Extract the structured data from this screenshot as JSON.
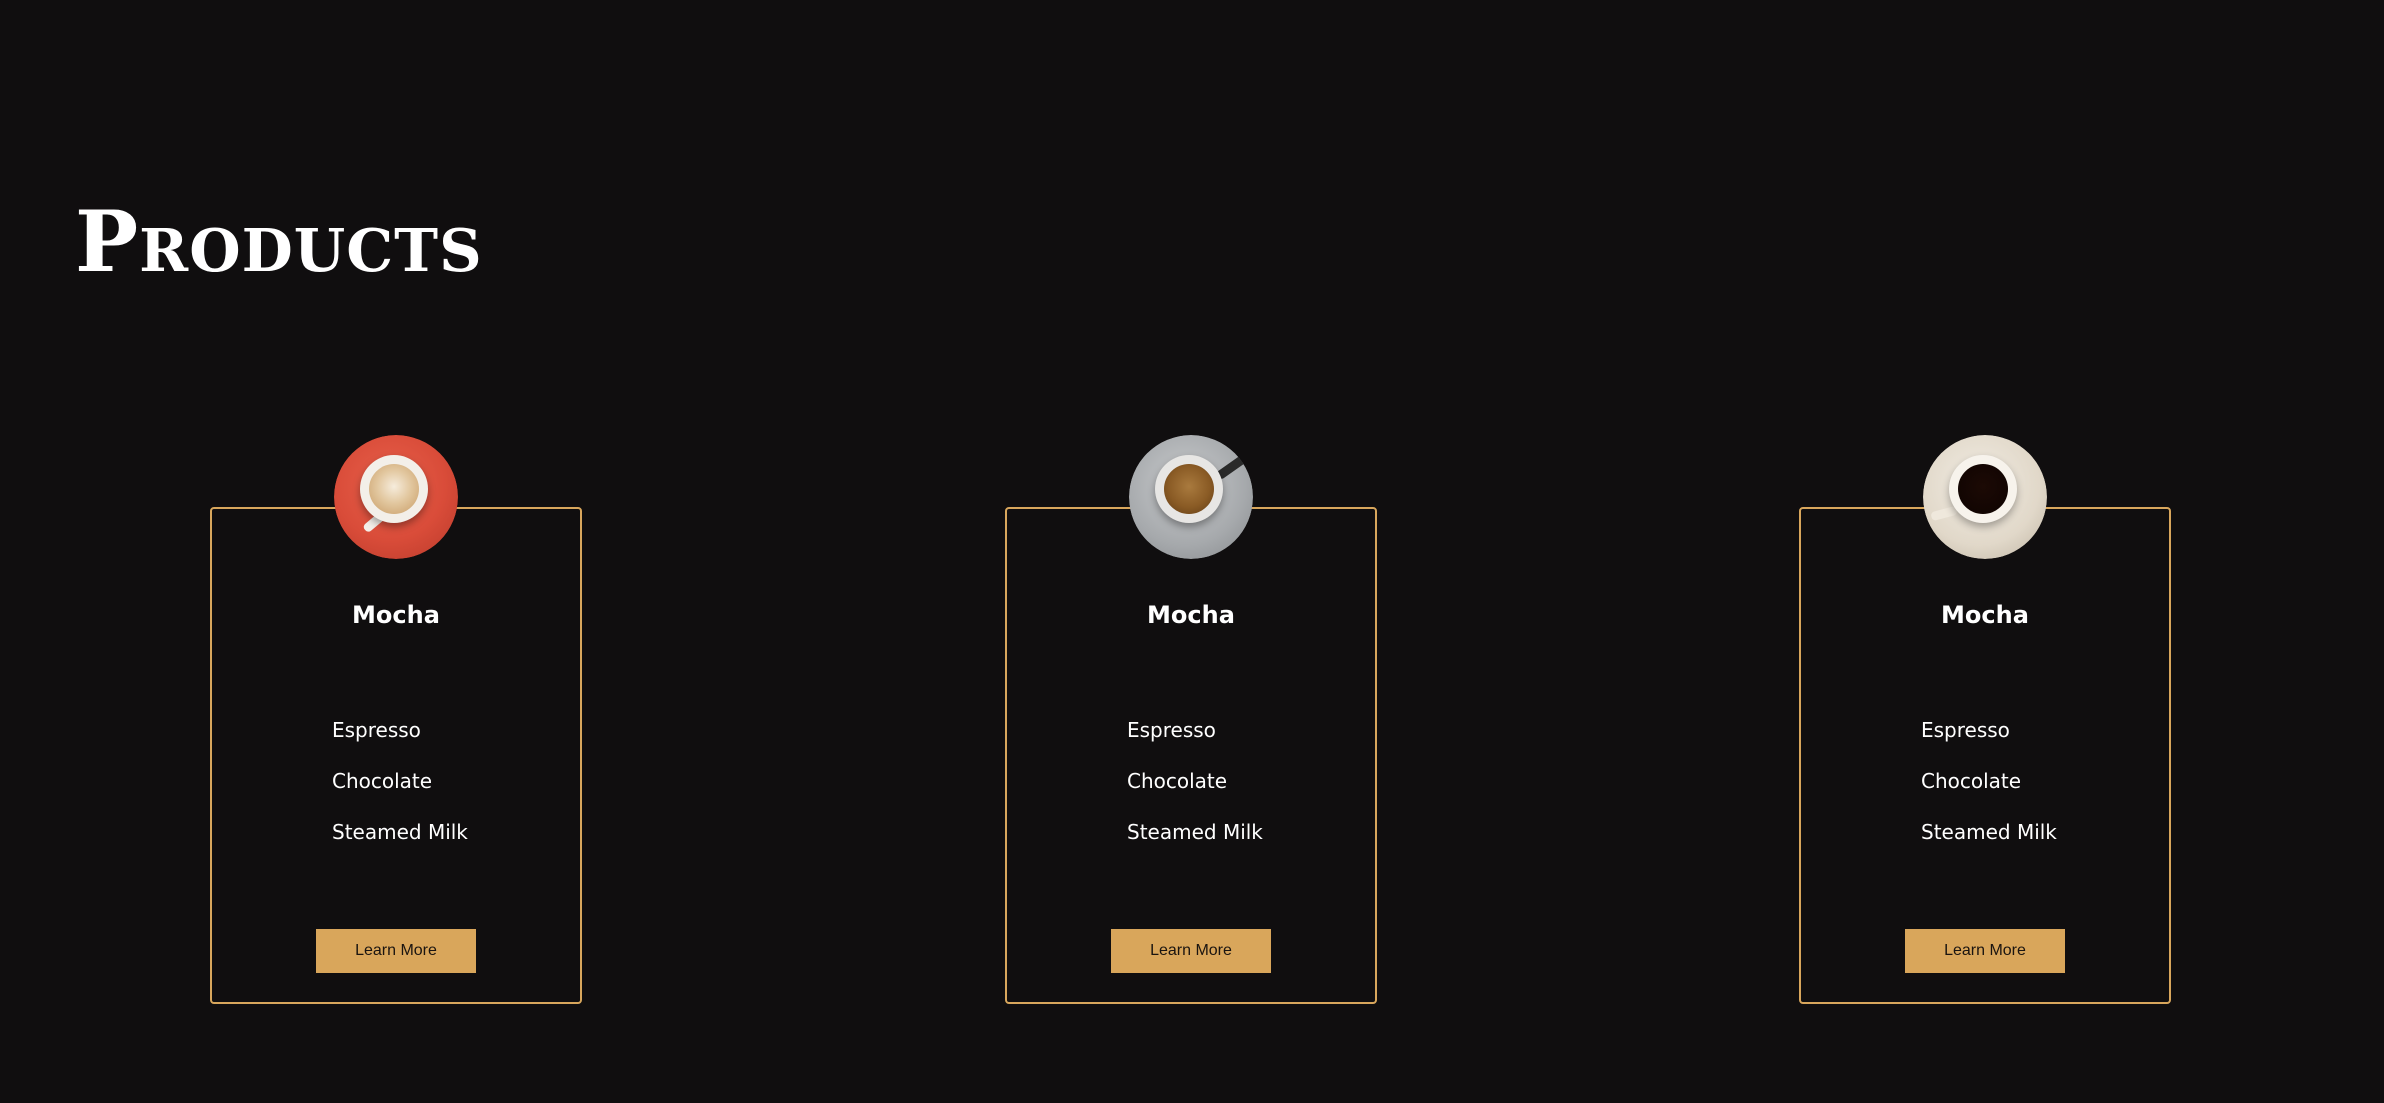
{
  "page": {
    "title": "Products"
  },
  "colors": {
    "background": "#100e0f",
    "accent": "#d9a65b",
    "text": "#ffffff"
  },
  "products": [
    {
      "name": "Mocha",
      "image": "latte-cup-on-red-saucer",
      "ingredients": [
        "Espresso",
        "Chocolate",
        "Steamed Milk"
      ],
      "button_label": "Learn More"
    },
    {
      "name": "Mocha",
      "image": "espresso-cup-on-grey-saucer",
      "ingredients": [
        "Espresso",
        "Chocolate",
        "Steamed Milk"
      ],
      "button_label": "Learn More"
    },
    {
      "name": "Mocha",
      "image": "black-coffee-cup-on-cream-saucer",
      "ingredients": [
        "Espresso",
        "Chocolate",
        "Steamed Milk"
      ],
      "button_label": "Learn More"
    }
  ]
}
